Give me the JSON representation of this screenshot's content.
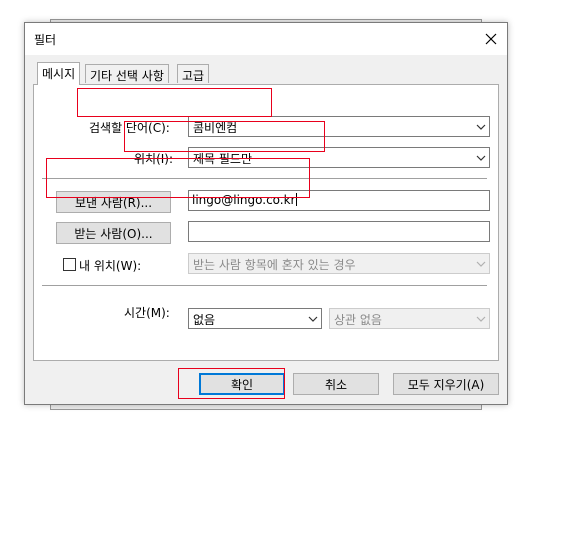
{
  "dialog": {
    "title": "필터"
  },
  "tabs": [
    {
      "label": "메시지"
    },
    {
      "label": "기타 선택 사항"
    },
    {
      "label": "고급"
    }
  ],
  "search_word": {
    "label": "검색할 단어(C):",
    "value": "콤비엔컴"
  },
  "location": {
    "label": "위치(I):",
    "value": "제목 필드만"
  },
  "from": {
    "button_label": "보낸 사람(R)...",
    "value": "lingo@lingo.co.kr"
  },
  "to": {
    "button_label": "받는 사람(O)...",
    "value": ""
  },
  "where_i_am": {
    "label": "내 위치(W):",
    "value": "받는 사람 항목에 혼자 있는 경우",
    "checked": false
  },
  "time": {
    "label": "시간(M):",
    "value": "없음",
    "secondary_value": "상관 없음"
  },
  "buttons": {
    "ok": "확인",
    "cancel": "취소",
    "clear_all": "모두 지우기(A)"
  },
  "colors": {
    "highlight": "#e8001c",
    "focus": "#0078d7"
  }
}
